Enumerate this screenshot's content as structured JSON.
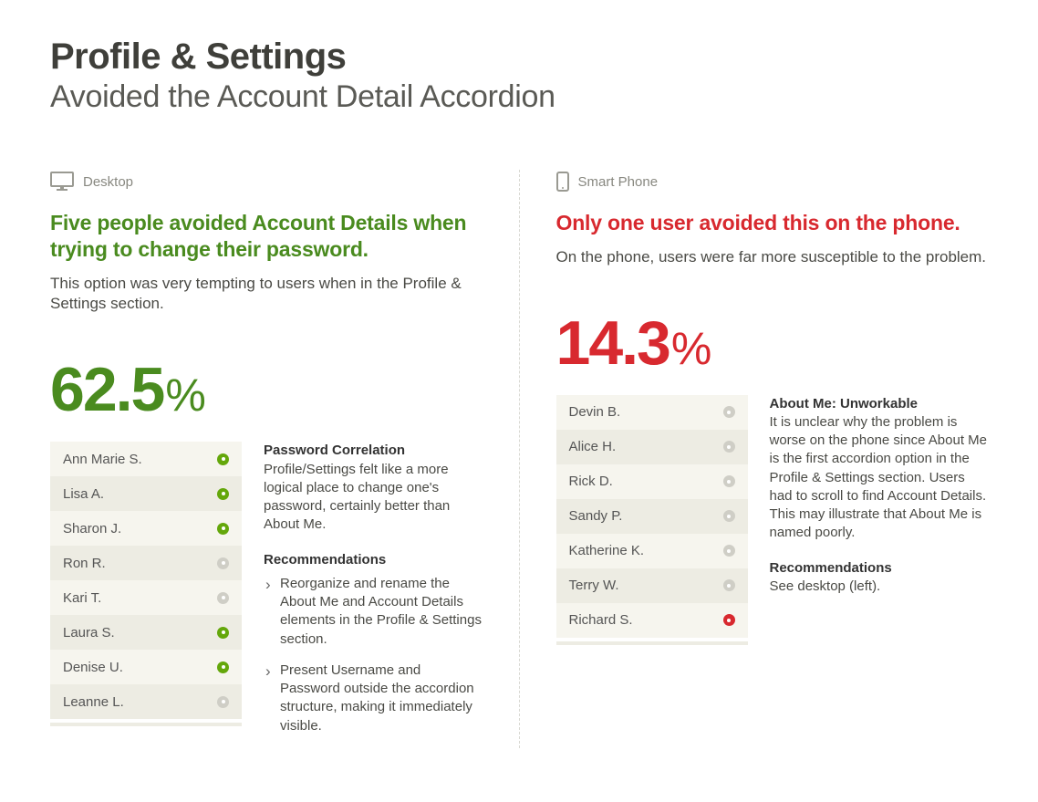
{
  "header": {
    "title": "Profile & Settings",
    "subtitle": "Avoided the Account Detail Accordion"
  },
  "left": {
    "device_label": "Desktop",
    "headline": "Five people avoided Account Details when trying to change their password.",
    "sub": "This option was very tempting to users when in the Profile & Settings section.",
    "stat_num": "62.5",
    "stat_pct": "%",
    "participants": [
      {
        "name": "Ann Marie S.",
        "status": "on"
      },
      {
        "name": "Lisa A.",
        "status": "on"
      },
      {
        "name": "Sharon J.",
        "status": "on"
      },
      {
        "name": "Ron R.",
        "status": "off"
      },
      {
        "name": "Kari T.",
        "status": "off"
      },
      {
        "name": "Laura S.",
        "status": "on"
      },
      {
        "name": "Denise U.",
        "status": "on"
      },
      {
        "name": "Leanne L.",
        "status": "off"
      }
    ],
    "note_title": "Password Correlation",
    "note_body": "Profile/Settings felt like a more logical place to change one's password, certainly better than About Me.",
    "rec_title": "Recommendations",
    "recs": [
      "Reorganize and rename the About Me and Account Details elements in the Profile & Settings section.",
      "Present Username and Password outside the accordion structure, making it immediately visible."
    ]
  },
  "right": {
    "device_label": "Smart Phone",
    "headline": "Only one user avoided this on the phone.",
    "sub": "On the phone, users were far more susceptible to the problem.",
    "stat_num": "14.3",
    "stat_pct": "%",
    "participants": [
      {
        "name": "Devin B.",
        "status": "off"
      },
      {
        "name": "Alice H.",
        "status": "off"
      },
      {
        "name": "Rick D.",
        "status": "off"
      },
      {
        "name": "Sandy P.",
        "status": "off"
      },
      {
        "name": "Katherine K.",
        "status": "off"
      },
      {
        "name": "Terry W.",
        "status": "off"
      },
      {
        "name": "Richard S.",
        "status": "on"
      }
    ],
    "note_title": "About Me: Unworkable",
    "note_body": "It is unclear why the problem is worse on the phone since About Me is the first accordion option in the Profile & Settings section. Users had to scroll to find Account Details. This may illustrate that About Me is named poorly.",
    "rec_title": "Recommendations",
    "rec_body": "See desktop (left)."
  }
}
